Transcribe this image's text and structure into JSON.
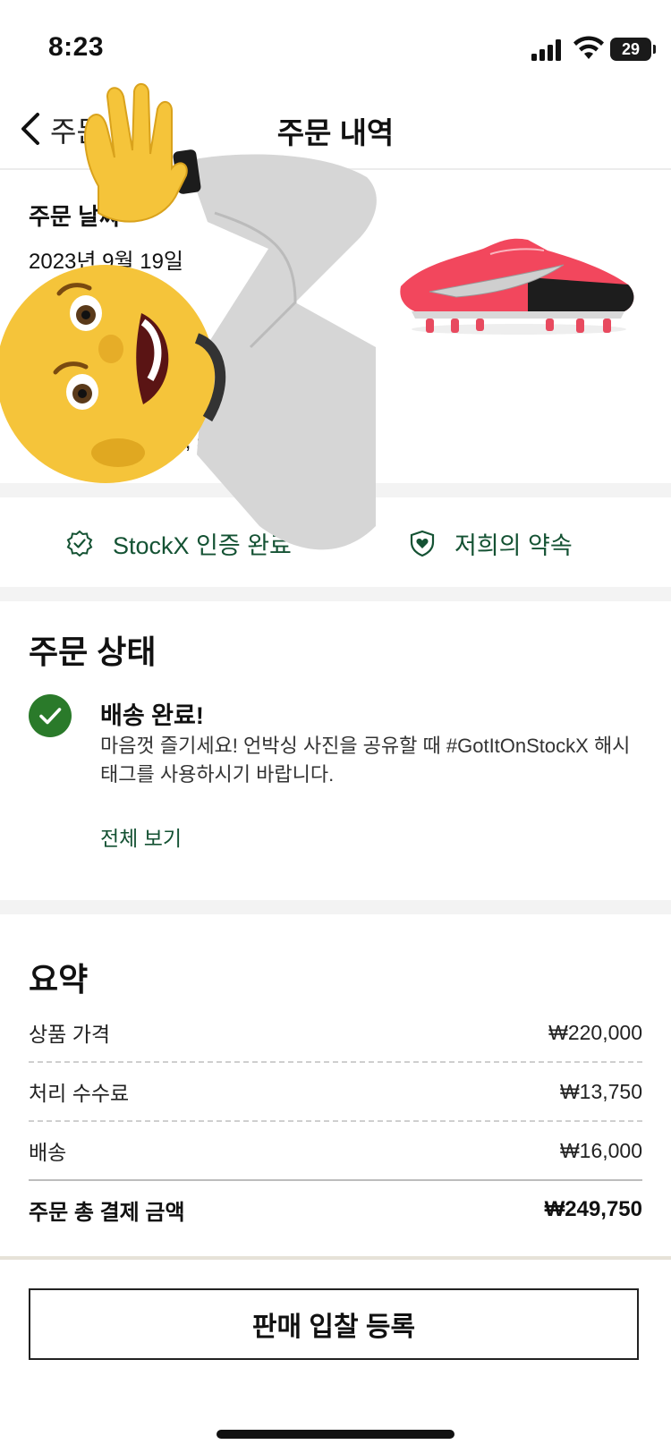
{
  "status_bar": {
    "time": "8:23",
    "battery": "29"
  },
  "header": {
    "back_label": "주문",
    "title": "주문 내역"
  },
  "order": {
    "date_label": "주문 날짜",
    "date_value": "2023년 9월 19일",
    "address_fragment": "gu, se"
  },
  "badges": [
    {
      "label": "StockX 인증 완료",
      "icon": "seal-check-icon"
    },
    {
      "label": "저희의 약속",
      "icon": "shield-heart-icon"
    }
  ],
  "order_status": {
    "section_title": "주문 상태",
    "headline": "배송 완료!",
    "description": "마음껏 즐기세요! 언박싱 사진을 공유할 때 #GotItOnStockX 해시태그를 사용하시기 바랍니다.",
    "view_all": "전체 보기"
  },
  "summary": {
    "title": "요약",
    "rows": [
      {
        "label": "상품 가격",
        "value": "₩220,000"
      },
      {
        "label": "처리 수수료",
        "value": "₩13,750"
      },
      {
        "label": "배송",
        "value": "₩16,000"
      }
    ],
    "total": {
      "label": "주문 총 결제 금액",
      "value": "₩249,750"
    }
  },
  "cta": {
    "label": "판매 입찰 등록"
  },
  "colors": {
    "accent_green": "#145233",
    "check_green": "#2a7a2a",
    "shoe_pink": "#f2475d"
  }
}
